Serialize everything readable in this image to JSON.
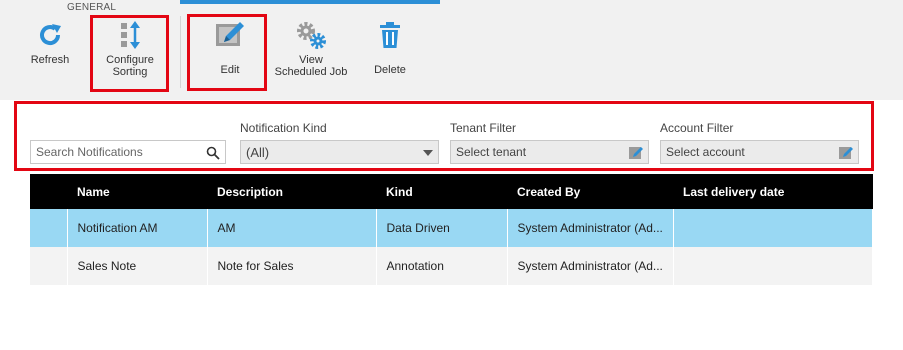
{
  "ribbon": {
    "group_label": "GENERAL",
    "buttons": {
      "refresh": "Refresh",
      "configure_sorting": "Configure Sorting",
      "edit": "Edit",
      "view_scheduled_job": "View Scheduled Job",
      "delete": "Delete"
    }
  },
  "filters": {
    "search_placeholder": "Search Notifications",
    "notification_kind_label": "Notification Kind",
    "notification_kind_value": "(All)",
    "tenant_filter_label": "Tenant Filter",
    "tenant_filter_value": "Select tenant",
    "account_filter_label": "Account Filter",
    "account_filter_value": "Select account"
  },
  "grid": {
    "columns": [
      "Name",
      "Description",
      "Kind",
      "Created By",
      "Last delivery date"
    ],
    "rows": [
      {
        "name": "Notification AM",
        "description": "AM",
        "kind": "Data Driven",
        "created_by": "System Administrator (Ad...",
        "last_delivery": "",
        "selected": true
      },
      {
        "name": "Sales Note",
        "description": "Note for Sales",
        "kind": "Annotation",
        "created_by": "System Administrator (Ad...",
        "last_delivery": "",
        "selected": false
      }
    ]
  },
  "colors": {
    "accent": "#2c8fd6",
    "highlight_red": "#e30613",
    "selected_row": "#99d8f3",
    "header_bg": "#000000"
  }
}
